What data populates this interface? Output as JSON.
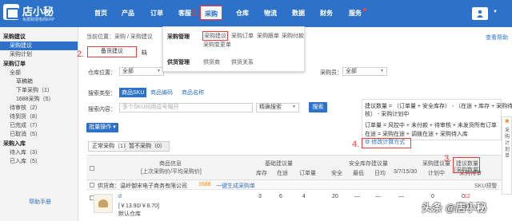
{
  "brand": {
    "name": "店小秘",
    "tagline": "免费跨境电商ERP"
  },
  "nav": {
    "items": [
      "首页",
      "产品",
      "订单",
      "客服",
      "采购",
      "仓库",
      "物流",
      "数据",
      "财务",
      "服务"
    ],
    "active": "采购"
  },
  "annotations": {
    "a1": "1.",
    "a2": "2.",
    "a3": "3.",
    "a4": "4."
  },
  "sidebar": {
    "groups": [
      {
        "title": "采购建议",
        "items": [
          "采购建议",
          "采购计划"
        ]
      },
      {
        "title": "采购订单",
        "items": [
          "全部",
          "草稿箱",
          "下单采购（1）",
          "1688采购（5）",
          "待审核（2）",
          "待到货（8）",
          "已完成（7）",
          "已取消（5）"
        ]
      },
      {
        "title": "采购入库",
        "items": [
          "待入库（3）",
          "已入库（5）"
        ]
      }
    ],
    "help": "帮助手册"
  },
  "breadcrumb": "当前位置：采购 / 采购建议",
  "help_link": "查看帮助",
  "subtabs": {
    "active": "备货建议",
    "other": "缺"
  },
  "dropdown": {
    "group1_label": "采购管理",
    "group1_items": [
      "采购建议",
      "采购订单",
      "采购跟单",
      "采购付款",
      "采购变更单"
    ],
    "group2_label": "供货管理",
    "group2_items": [
      "供货商",
      "供货关系"
    ]
  },
  "filters": {
    "warehouse_label": "仓库位置：",
    "warehouse_value": "全部",
    "purchaser_label": "采购员：",
    "purchaser_value": "全部",
    "search_type_label": "搜索类型：",
    "search_types": [
      "商品SKU",
      "商品编码",
      "商品名称"
    ],
    "search_content_label": "搜索内容：",
    "search_placeholder": "多个SKU间用逗号隔开",
    "match_value": "精确搜索",
    "search_button": "搜索",
    "batch_button": "批量操作"
  },
  "tooltip": {
    "lines": [
      "建议数量 = （订单量 + 安全库存） - （在途 + 库存 + 采购待审",
      "核） - 采购计划中",
      "订单量 = 风控中 + 未付款 + 待审核 + 未发货所有订单",
      "在途 = 采购在途 + 调拨在途 + 采购待入库"
    ],
    "formula_button": "修改计算方式"
  },
  "table": {
    "tabs": [
      "正常采购（1）",
      "暂不采购（0）"
    ],
    "headers": {
      "product": "商品信息",
      "product_sub": "[上次采购价/平均采购价]",
      "basic": "基础建议量",
      "basic_cols": [
        "库存",
        "在途",
        "订单量"
      ],
      "safety": "安全库存建议量",
      "safety_cols": [
        "安全",
        "最低",
        "日均",
        "3/7/15/30"
      ],
      "purchase": "采购建议量",
      "purchase_cols": [
        "计划中",
        "采购待审"
      ],
      "suggest": "建议数量",
      "suggest_sub": "[采购数量]",
      "sku_warn": "SKU预警"
    },
    "supplier_row": {
      "prefix": "供货商：",
      "name": "温岭御宋电子商务有限公司",
      "tag": "1688",
      "link": "一键生成采购单"
    },
    "rows": [
      {
        "sku": "d",
        "price": "[￥13.90/￥8.70]",
        "warehouse": "默认仓库",
        "stock": "3",
        "transit": "6",
        "orders": "4",
        "safe": "20",
        "min": "—",
        "daily": "—",
        "trend": "—",
        "planned": "0",
        "pending": "0",
        "suggest": "12",
        "purchase": "12"
      }
    ]
  },
  "float_bar": [
    "采",
    "购",
    "计",
    "划",
    "单"
  ],
  "watermark": "头条 @店小秘",
  "colors": {
    "primary": "#2d72c8",
    "highlight": "#e83b3b"
  }
}
